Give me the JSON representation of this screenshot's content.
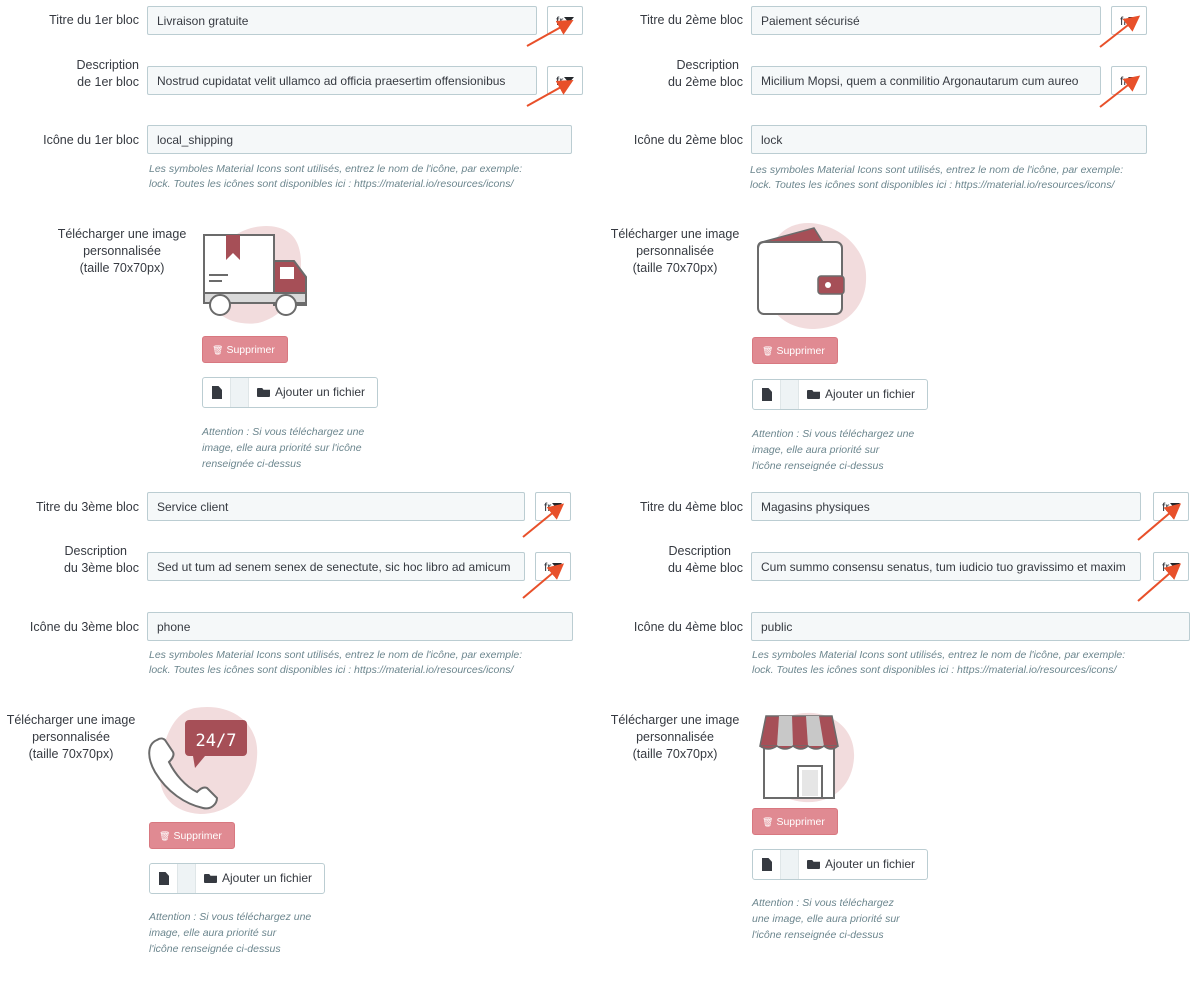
{
  "lang_label": "fr",
  "blocks": [
    {
      "title_label": "Titre du 1er bloc",
      "title_value": "Livraison gratuite",
      "desc_label_1": "Description",
      "desc_label_2": "de 1er bloc",
      "desc_value": "Nostrud cupidatat velit ullamco ad officia praesertim offensionibus",
      "icon_label": "Icône du 1er bloc",
      "icon_value": "local_shipping",
      "help_1": "Les symboles Material Icons sont utilisés, entrez le nom de l'icône, par exemple:",
      "help_2": "lock. Toutes les icônes sont disponibles ici : https://material.io/resources/icons/",
      "upload_1": "Télécharger une image",
      "upload_2": "personnalisée",
      "upload_3": "(taille 70x70px)",
      "image_icon": "delivery-truck-icon",
      "delete_label": "Supprimer",
      "add_file_label": "Ajouter un fichier",
      "attn_1": "Attention : Si vous téléchargez une",
      "attn_2": "image, elle aura priorité sur l'icône",
      "attn_3": "renseignée ci-dessus"
    },
    {
      "title_label": "Titre du 2ème bloc",
      "title_value": "Paiement sécurisé",
      "desc_label_1": "Description",
      "desc_label_2": "du 2ème bloc",
      "desc_value": "Micilium Mopsi, quem a conmilitio Argonautarum cum aureo",
      "icon_label": "Icône du 2ème bloc",
      "icon_value": "lock",
      "help_1": "Les symboles Material Icons sont utilisés, entrez le nom de l'icône, par exemple:",
      "help_2": "lock. Toutes les icônes sont disponibles ici : https://material.io/resources/icons/",
      "upload_1": "Télécharger une image",
      "upload_2": "personnalisée",
      "upload_3": "(taille 70x70px)",
      "image_icon": "wallet-icon",
      "delete_label": "Supprimer",
      "add_file_label": "Ajouter un fichier",
      "attn_1": "Attention : Si vous téléchargez une",
      "attn_2": "image, elle aura priorité sur",
      "attn_3": "l'icône renseignée ci-dessus"
    },
    {
      "title_label": "Titre du 3ème bloc",
      "title_value": "Service client",
      "desc_label_1": "Description",
      "desc_label_2": "du 3ème bloc",
      "desc_value": "Sed ut tum ad senem senex de senectute, sic hoc libro ad amicum",
      "icon_label": "Icône du 3ème bloc",
      "icon_value": "phone",
      "help_1": "Les symboles Material Icons sont utilisés, entrez le nom de l'icône, par exemple:",
      "help_2": "lock. Toutes les icônes  sont disponibles ici : https://material.io/resources/icons/",
      "upload_1": "Télécharger une image",
      "upload_2": "personnalisée",
      "upload_3": "(taille 70x70px)",
      "image_icon": "phone-24-7-icon",
      "image_badge": "24/7",
      "delete_label": "Supprimer",
      "add_file_label": "Ajouter un fichier",
      "attn_1": "Attention : Si vous téléchargez une",
      "attn_2": "image, elle aura priorité sur",
      "attn_3": "l'icône renseignée ci-dessus"
    },
    {
      "title_label": "Titre du 4ème bloc",
      "title_value": "Magasins physiques",
      "desc_label_1": "Description",
      "desc_label_2": "du 4ème bloc",
      "desc_value": "Cum summo consensu senatus, tum iudicio tuo gravissimo et maxim",
      "icon_label": "Icône du 4ème bloc",
      "icon_value": "public",
      "help_1": "Les symboles Material Icons sont utilisés, entrez le nom de l'icône, par exemple:",
      "help_2": "lock. Toutes les icônes sont disponibles ici : https://material.io/resources/icons/",
      "upload_1": "Télécharger une image",
      "upload_2": "personnalisée",
      "upload_3": "(taille 70x70px)",
      "image_icon": "storefront-icon",
      "delete_label": "Supprimer",
      "add_file_label": "Ajouter un fichier",
      "attn_1": "Attention : Si vous téléchargez",
      "attn_2": "une image, elle aura priorité sur",
      "attn_3": "l'icône renseignée ci-dessus"
    }
  ],
  "colors": {
    "accent": "#a64f57",
    "delete_button": "#e08a92",
    "blob": "#f2dcdd",
    "arrow": "#e8502a"
  }
}
